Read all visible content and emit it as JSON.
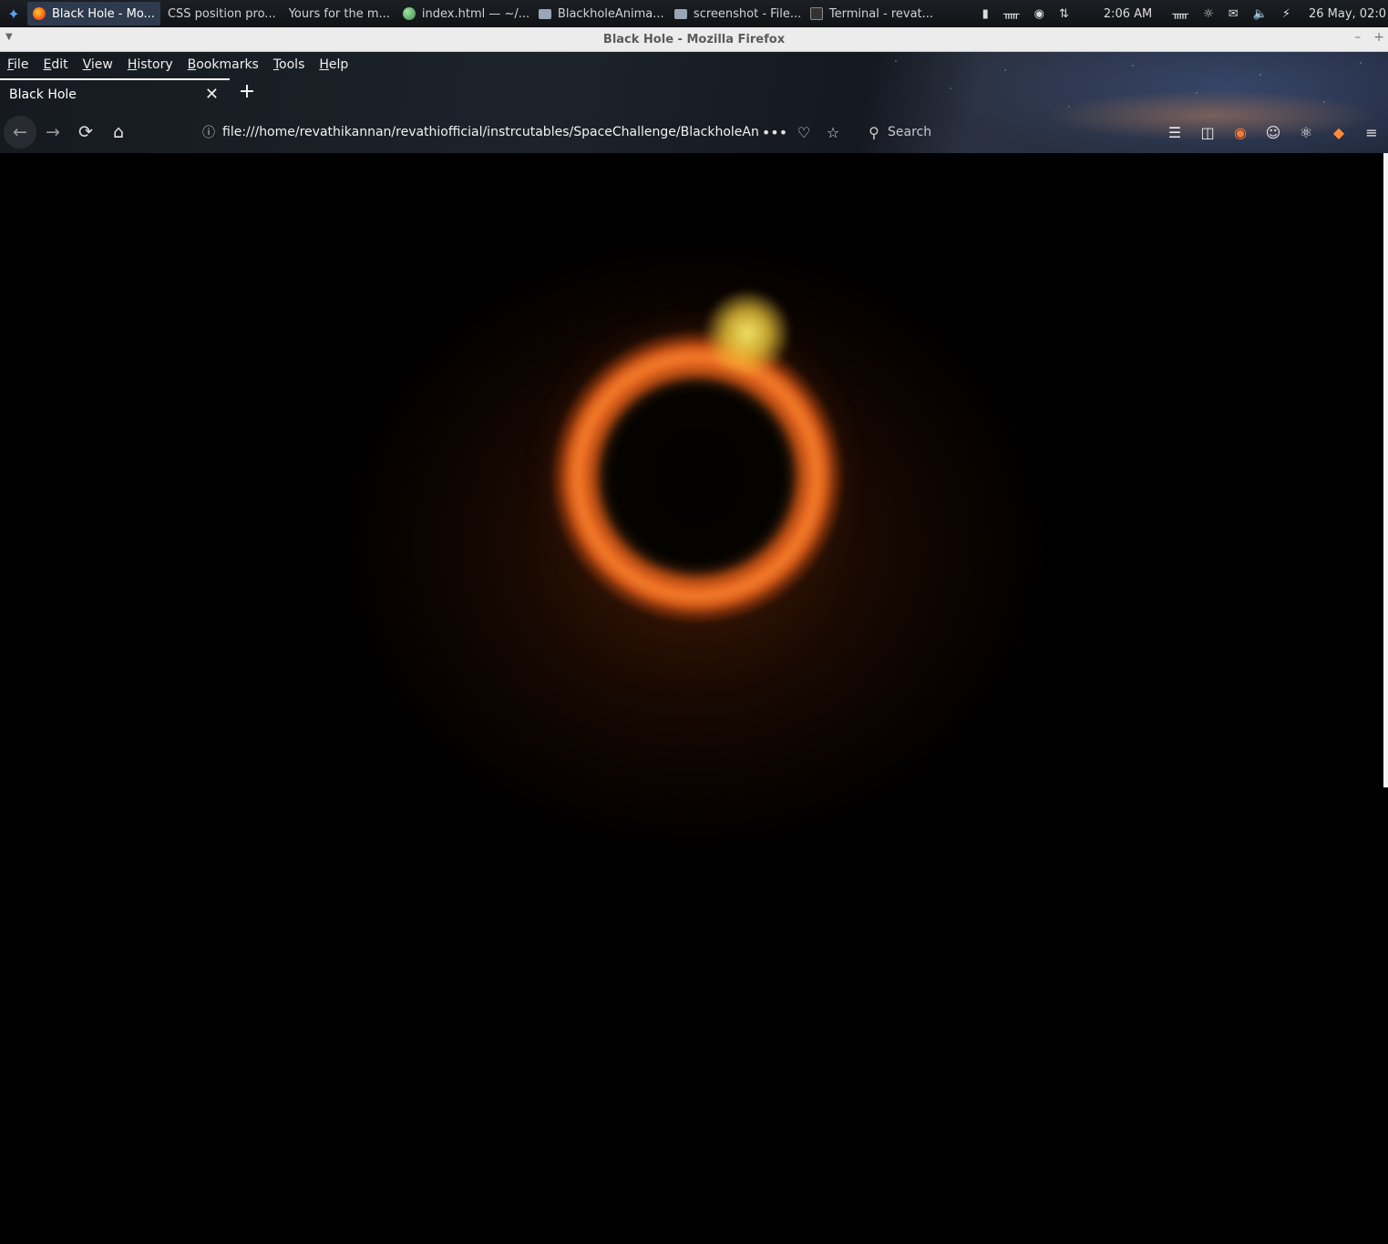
{
  "taskbar": {
    "tasks": [
      {
        "label": "Black Hole - Mo...",
        "icon": "firefox-icon",
        "active": true
      },
      {
        "label": "CSS position pro...",
        "icon": "chrome-icon"
      },
      {
        "label": "Yours for the m...",
        "icon": "chrome-icon"
      },
      {
        "label": "index.html — ~/...",
        "icon": "globe-icon"
      },
      {
        "label": "BlackholeAnima...",
        "icon": "folder-icon"
      },
      {
        "label": "screenshot - File...",
        "icon": "folder-icon"
      },
      {
        "label": "Terminal - revat...",
        "icon": "terminal-icon"
      }
    ],
    "time": "2:06 AM",
    "date": "26 May, 02:0"
  },
  "window": {
    "title": "Black Hole - Mozilla Firefox"
  },
  "menu": {
    "items": [
      "File",
      "Edit",
      "View",
      "History",
      "Bookmarks",
      "Tools",
      "Help"
    ]
  },
  "tab": {
    "title": "Black Hole"
  },
  "navigation": {
    "url": "file:///home/revathikannan/revathiofficial/instrcutables/SpaceChallenge/BlackholeAnimation",
    "search_placeholder": "Search"
  },
  "colors": {
    "ring_orange": "#ee6e22",
    "hotspot_yellow": "#ffe86e",
    "background": "#000000"
  }
}
